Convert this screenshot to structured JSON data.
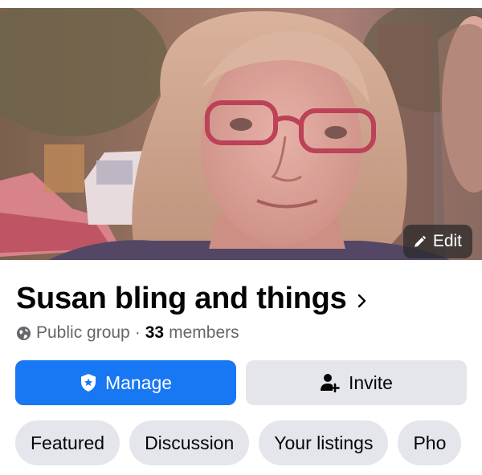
{
  "cover": {
    "edit_label": "Edit"
  },
  "group": {
    "name": "Susan bling and things",
    "privacy": "Public group",
    "separator": "·",
    "member_count": "33",
    "members_label": "members"
  },
  "actions": {
    "manage_label": "Manage",
    "invite_label": "Invite"
  },
  "tabs": [
    {
      "label": "Featured"
    },
    {
      "label": "Discussion"
    },
    {
      "label": "Your listings"
    },
    {
      "label": "Pho"
    }
  ],
  "colors": {
    "primary": "#1877f2",
    "button_gray": "#e4e6eb",
    "secondary_text": "#65676b"
  }
}
